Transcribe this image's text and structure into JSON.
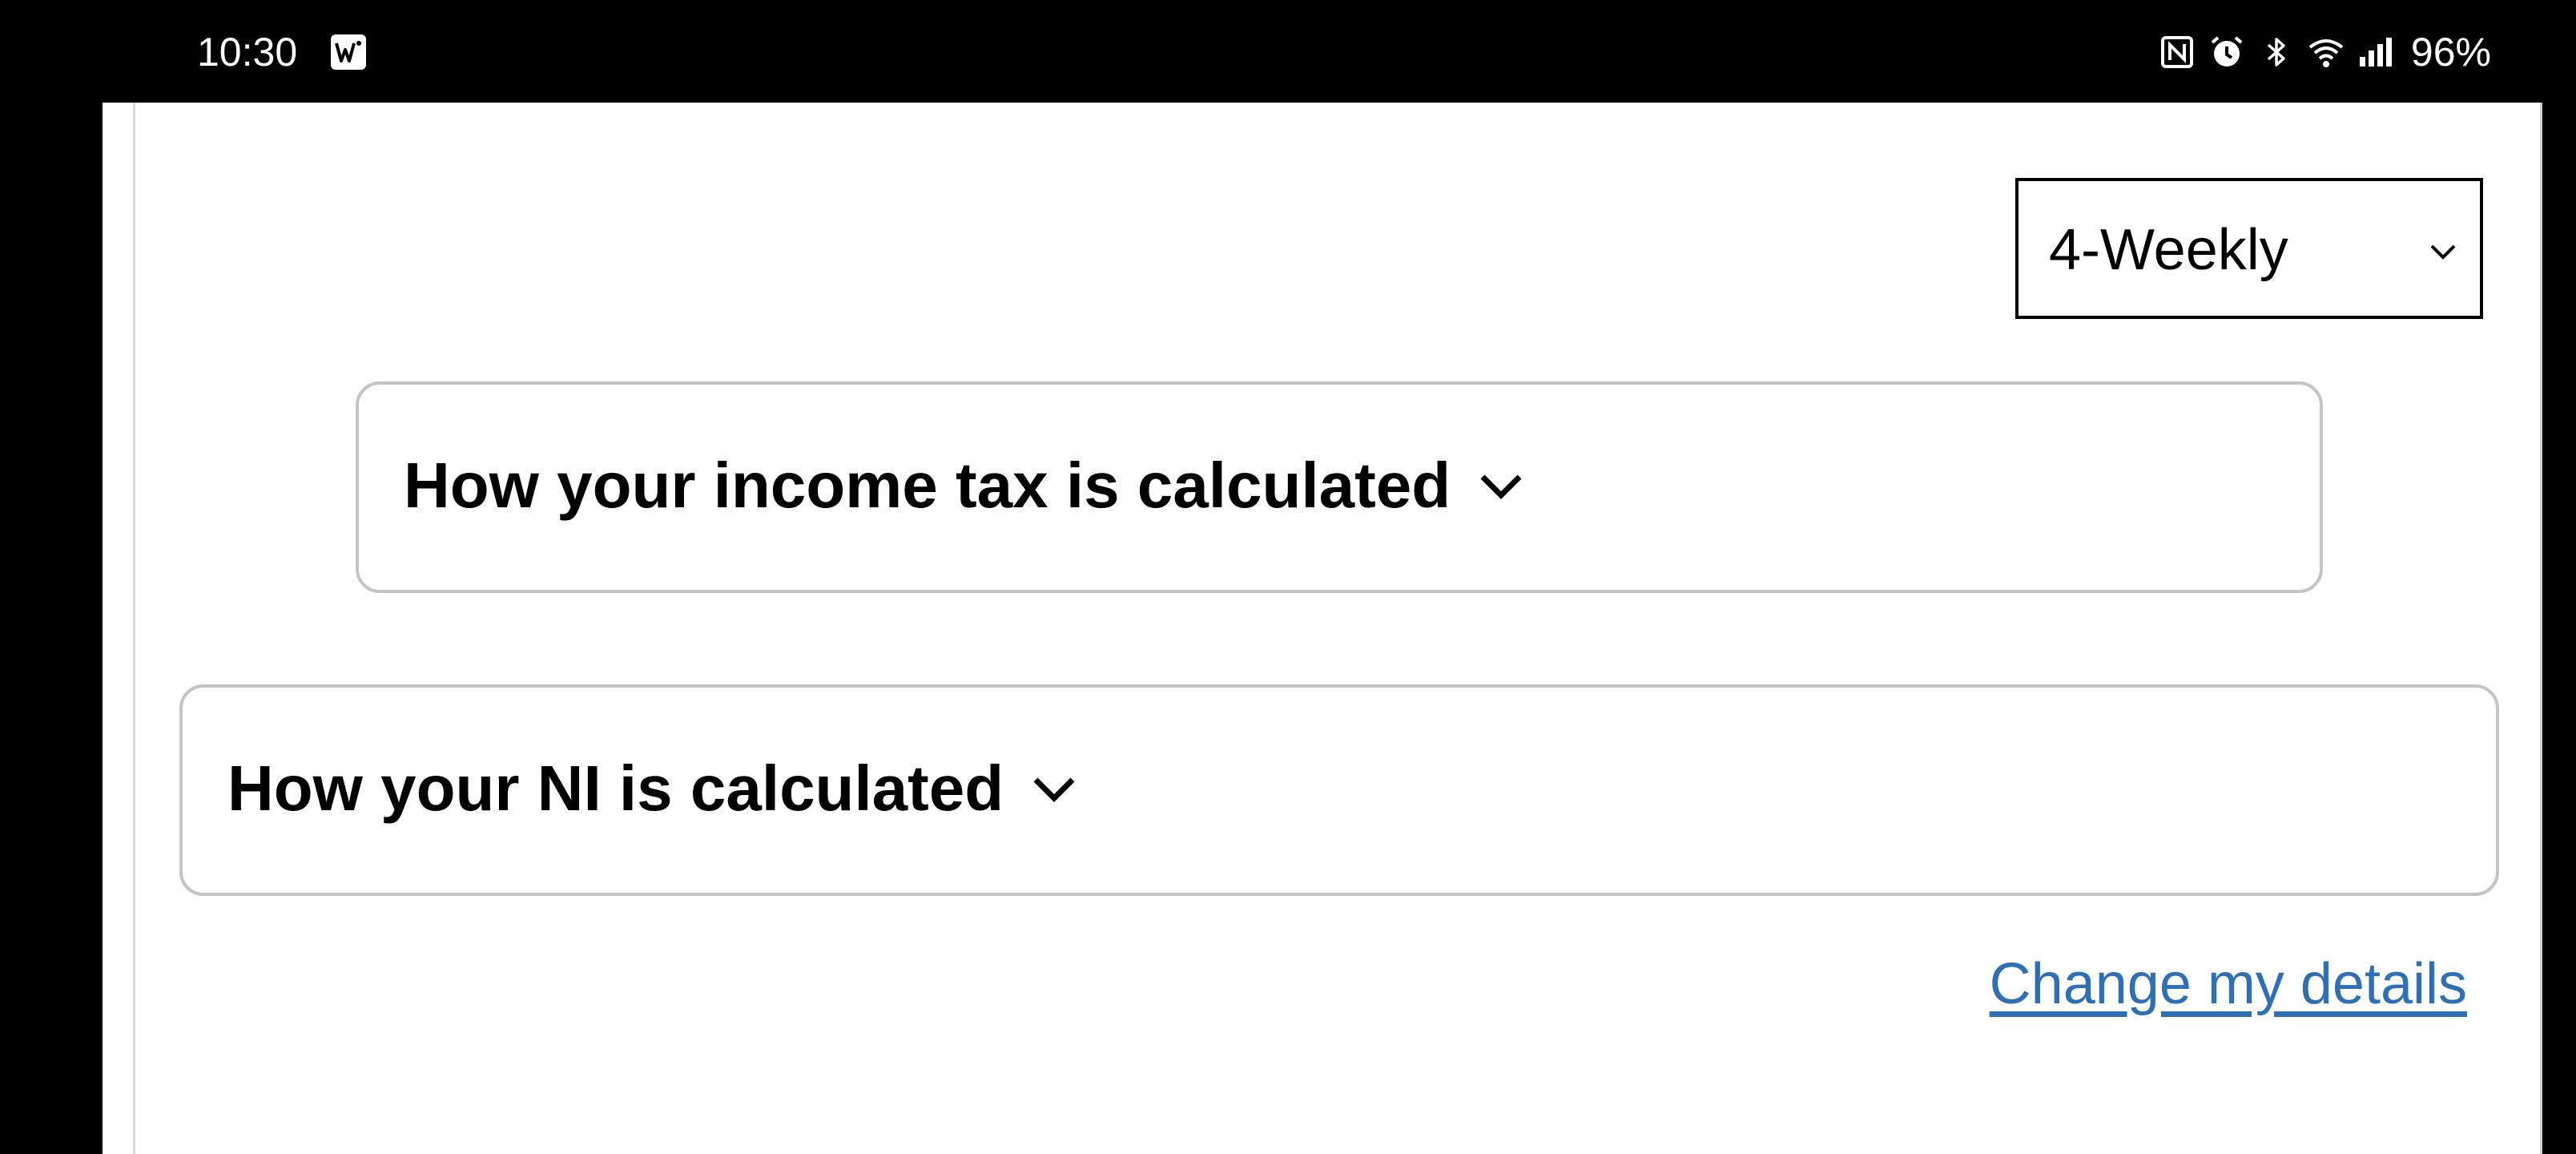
{
  "status_bar": {
    "time": "10:30",
    "app_icon": "w-app-icon",
    "icons": [
      "nfc-icon",
      "alarm-icon",
      "bluetooth-icon",
      "wifi-icon",
      "signal-icon"
    ],
    "battery": "96%"
  },
  "pay_period": {
    "selected": "4-Weekly"
  },
  "accordions": [
    {
      "title": "How your income tax is calculated"
    },
    {
      "title": "How your NI is calculated"
    }
  ],
  "links": {
    "change_details": "Change my details"
  },
  "colors": {
    "link": "#2f6fb5",
    "accordion_border": "#c4c4c4",
    "status_bar_bg": "#000000",
    "page_bg": "#ffffff"
  }
}
